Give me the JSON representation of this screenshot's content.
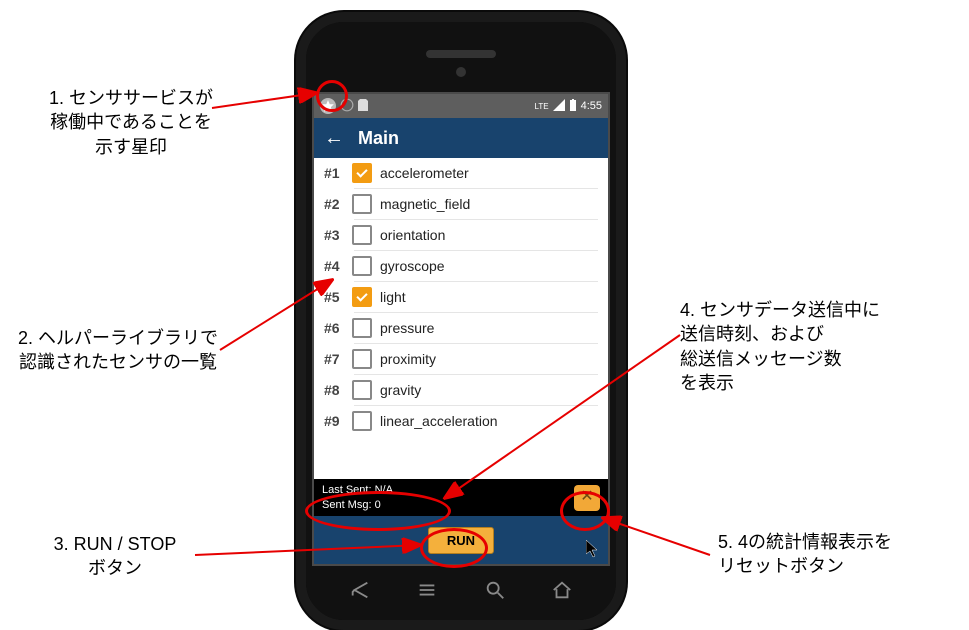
{
  "statusbar": {
    "network_label": "LTE",
    "time": "4:55"
  },
  "titlebar": {
    "back_glyph": "←",
    "title": "Main"
  },
  "sensors": [
    {
      "num": "#1",
      "label": "accelerometer",
      "checked": true
    },
    {
      "num": "#2",
      "label": "magnetic_field",
      "checked": false
    },
    {
      "num": "#3",
      "label": "orientation",
      "checked": false
    },
    {
      "num": "#4",
      "label": "gyroscope",
      "checked": false
    },
    {
      "num": "#5",
      "label": "light",
      "checked": true
    },
    {
      "num": "#6",
      "label": "pressure",
      "checked": false
    },
    {
      "num": "#7",
      "label": "proximity",
      "checked": false
    },
    {
      "num": "#8",
      "label": "gravity",
      "checked": false
    },
    {
      "num": "#9",
      "label": "linear_acceleration",
      "checked": false
    }
  ],
  "stats": {
    "last_sent_label": "Last Sent:",
    "last_sent_value": "N/A",
    "sent_msg_label": "Sent Msg:",
    "sent_msg_value": "0",
    "reset_glyph": "✕"
  },
  "runbar": {
    "run_label": "RUN"
  },
  "annotations": {
    "a1_num": "1.",
    "a1_text": "センササービスが\n稼働中であることを\n示す星印",
    "a2_num": "2.",
    "a2_text": "ヘルパーライブラリで\n認識されたセンサの一覧",
    "a3_num": "3.",
    "a3_text": "RUN / STOP\nボタン",
    "a4_num": "4.",
    "a4_text": "センサデータ送信中に\n送信時刻、および\n総送信メッセージ数\nを表示",
    "a5_num": "5.",
    "a5_text": "4の統計情報表示を\nリセットボタン"
  }
}
